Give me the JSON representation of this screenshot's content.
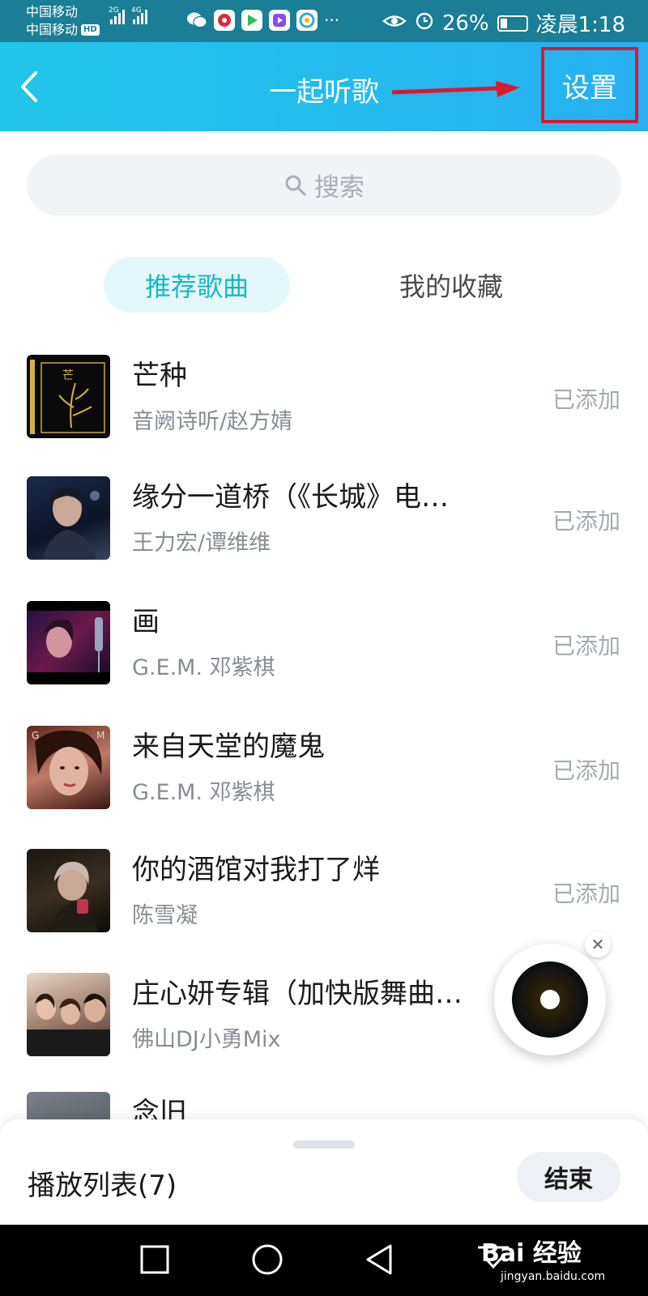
{
  "status_bar": {
    "carrier1": "中国移动",
    "carrier2": "中国移动",
    "hd": "HD",
    "net1": "2G",
    "net2": "4G",
    "more": "···",
    "battery": "26%",
    "battery_level": 0.26,
    "time": "凌晨1:18"
  },
  "header": {
    "title": "一起听歌",
    "settings_label": "设置"
  },
  "search": {
    "placeholder": "搜索"
  },
  "tabs": [
    {
      "label": "推荐歌曲",
      "active": true
    },
    {
      "label": "我的收藏",
      "active": false
    }
  ],
  "songs": [
    {
      "title": "芒种",
      "artist": "音阙诗听/赵方婧",
      "status": "已添加"
    },
    {
      "title": "缘分一道桥（《长城》电…",
      "artist": "王力宏/谭维维",
      "status": "已添加"
    },
    {
      "title": "画",
      "artist": "G.E.M. 邓紫棋",
      "status": "已添加"
    },
    {
      "title": "来自天堂的魔鬼",
      "artist": "G.E.M. 邓紫棋",
      "status": "已添加"
    },
    {
      "title": "你的酒馆对我打了烊",
      "artist": "陈雪凝",
      "status": "已添加"
    },
    {
      "title": "庄心妍专辑（加快版舞曲…",
      "artist": "佛山DJ小勇Mix",
      "status": ""
    },
    {
      "title": "念旧",
      "artist": "",
      "status": ""
    }
  ],
  "bottom": {
    "playlist_label": "播放列表(7)",
    "end_label": "结束"
  },
  "watermark": {
    "main": "Bai 经验",
    "sub": "jingyan.baidu.com"
  }
}
